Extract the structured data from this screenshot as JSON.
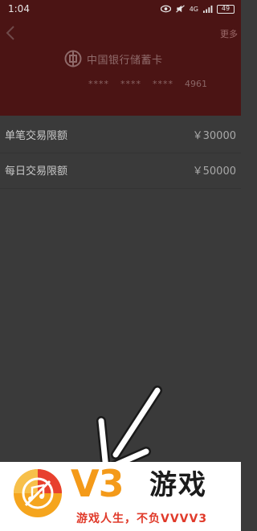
{
  "status_bar": {
    "time": "1:04",
    "network": "4G",
    "battery": "49"
  },
  "header": {
    "back_icon": "chevron-left-icon",
    "more_label": "更多"
  },
  "card": {
    "bank_logo": "boc-logo-icon",
    "bank_name": "中国银行储蓄卡",
    "mask1": "****",
    "mask2": "****",
    "mask3": "****",
    "last4": "4961"
  },
  "limits": [
    {
      "label": "单笔交易限额",
      "value": "￥30000"
    },
    {
      "label": "每日交易限额",
      "value": "￥50000"
    }
  ],
  "overlay": {
    "arrow_icon": "arrow-down-left-icon"
  },
  "watermark": {
    "brand": "V3",
    "name": "游戏",
    "slogan": "游戏人生，不负VVVV3"
  },
  "colors": {
    "card_bg": "#4b1414",
    "page_bg": "#3a3a3a",
    "brand_orange": "#f49a19",
    "slogan_red": "#e03a2a"
  }
}
